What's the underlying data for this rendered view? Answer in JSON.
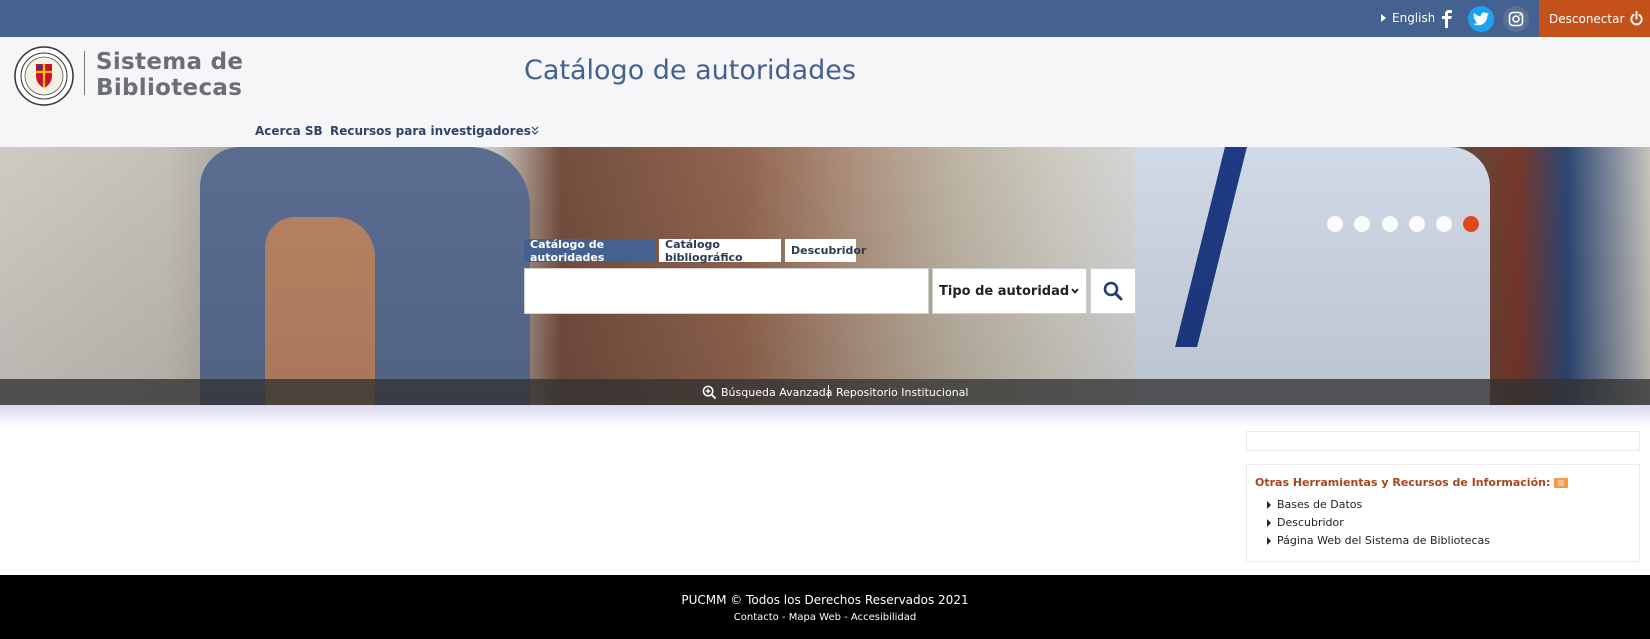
{
  "topbar": {
    "language_label": "English",
    "social": [
      {
        "icon": "facebook-icon"
      },
      {
        "icon": "twitter-icon"
      },
      {
        "icon": "instagram-icon"
      }
    ],
    "logout_label": "Desconectar",
    "colors": {
      "bar": "#44618f",
      "logout": "#c4501a",
      "twitter": "#1da1f2"
    }
  },
  "header": {
    "logo_line1": "Sistema de",
    "logo_line2": "Bibliotecas",
    "title": "Catálogo de autoridades",
    "nav": [
      {
        "label": "Acerca SB"
      },
      {
        "label": "Recursos para investigadores"
      }
    ]
  },
  "hero": {
    "carousel_active_index": 6,
    "carousel_count": 6,
    "tabs": [
      {
        "label": "Catálogo de autoridades",
        "active": true
      },
      {
        "label": "Catálogo bibliográfico",
        "active": false
      },
      {
        "label": "Descubridor",
        "active": false
      }
    ],
    "search": {
      "value": "",
      "select_value": "Tipo de autoridad"
    },
    "bar": {
      "advanced_label": "Búsqueda Avanzada",
      "repository_label": "Repositorio Institucional"
    }
  },
  "sidebar": {
    "title": "Otras Herramientas y Recursos de Información:",
    "items": [
      {
        "label": "Bases de Datos"
      },
      {
        "label": "Descubridor"
      },
      {
        "label": "Página Web del Sistema de Bibliotecas"
      }
    ]
  },
  "footer": {
    "copyright": "PUCMM © Todos los Derechos Reservados 2021",
    "links": "Contacto - Mapa Web - Accesibilidad"
  }
}
